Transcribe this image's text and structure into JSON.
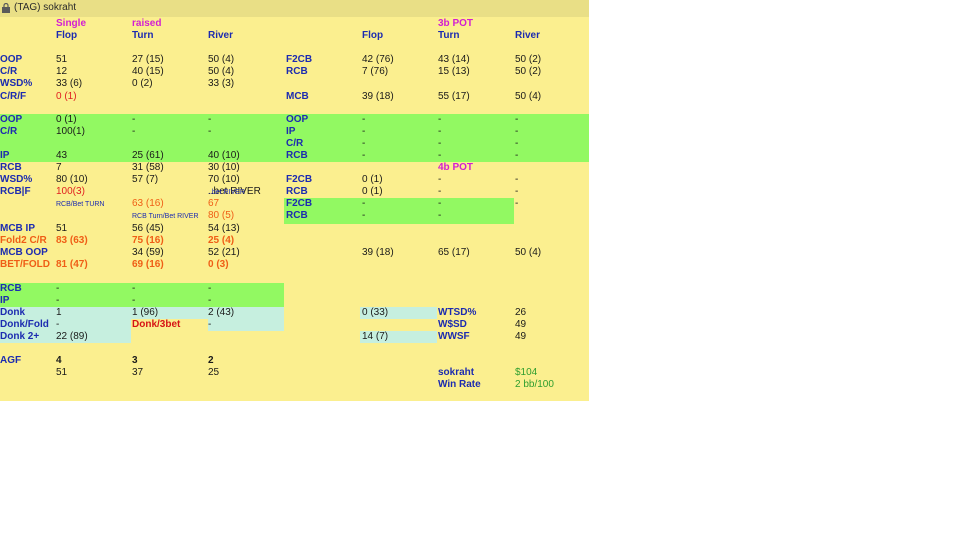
{
  "window": {
    "title": "(TAG) sokraht"
  },
  "colors": {
    "background": "#fbef8f",
    "label": "#1c2bb0",
    "accent": "#d21ed2",
    "green": "#92f962",
    "cyan": "#c6efdf"
  },
  "cells": {
    "h_single": "Single",
    "h_raised": "raised",
    "h_3bpot": "3b POT",
    "h_flop1": "Flop",
    "h_turn1": "Turn",
    "h_river1": "River",
    "h_flop2": "Flop",
    "h_turn2": "Turn",
    "h_river2": "River",
    "r1_l": "OOP",
    "r1_a": "51",
    "r1_b": "27 (15)",
    "r1_c": "50 (4)",
    "r1_l2": "F2CB",
    "r1_d": "42 (76)",
    "r1_e": "43 (14)",
    "r1_f": "50 (2)",
    "r2_l": "C/R",
    "r2_a": "12",
    "r2_b": "40 (15)",
    "r2_c": "50 (4)",
    "r2_l2": "RCB",
    "r2_d": "7 (76)",
    "r2_e": "15 (13)",
    "r2_f": "50 (2)",
    "r3_l": "WSD%",
    "r3_a": "33 (6)",
    "r3_b": "0 (2)",
    "r3_c": "33 (3)",
    "r4_l": "C/R/F",
    "r4_a": "0 (1)",
    "r4_l2": "MCB",
    "r4_d": "39 (18)",
    "r4_e": "55 (17)",
    "r4_f": "50 (4)",
    "g1_l": "OOP",
    "g1_a": "0 (1)",
    "g1_b": "-",
    "g1_c": "-",
    "g1_l2": "OOP",
    "g1_d": "-",
    "g1_e": "-",
    "g1_f": "-",
    "g2_l": "C/R",
    "g2_a": "100(1)",
    "g2_b": "-",
    "g2_c": "-",
    "g2_l2": "IP",
    "g2_d": "-",
    "g2_e": "-",
    "g2_f": "-",
    "g3_l2": "C/R",
    "g3_d": "-",
    "g3_e": "-",
    "g3_f": "-",
    "g4_l2": "RCB",
    "g4_d": "-",
    "g4_e": "-",
    "g4_f": "-",
    "ip_l": "IP",
    "ip_a": "43",
    "ip_b": "25 (61)",
    "ip_c": "40 (10)",
    "h_4bpot": "4b POT",
    "rcb_l": "RCB",
    "rcb_a": "7",
    "rcb_b": "31 (58)",
    "rcb_c": "30 (10)",
    "wsd2_l": "WSD%",
    "wsd2_a": "80 (10)",
    "wsd2_b": "57 (7)",
    "wsd2_c": "70 (10)",
    "f2cb2_l": "F2CB",
    "f2cb2_d": "0 (1)",
    "f2cb2_e": "-",
    "f2cb2_f": "-",
    "rcbf_l": "RCB|F",
    "rcbf_a": "100(3)",
    "rcbf_c": "..bet RIVER",
    "rcb3_l": "RCB",
    "rcb3_d": "0 (1)",
    "rcb3_e": "-",
    "rcb3_f": "-",
    "note_a": "RCB/Bet TURN",
    "note_b1": "63 (16)",
    "note_c1": "67",
    "g5_l": "F2CB",
    "g5_d": "-",
    "g5_e": "-",
    "g5_f": "-",
    "note_b2": "RCB Turn/Bet RIVER",
    "note_c2": "80 (5)",
    "g6_l": "RCB",
    "g6_d": "-",
    "g6_e": "-",
    "mcbip_l": "MCB IP",
    "mcbip_a": "51",
    "mcbip_b": "56 (45)",
    "mcbip_c": "54 (13)",
    "f2cr_l": "Fold2 C/R",
    "f2cr_a": "83 (63)",
    "f2cr_b": "75 (16)",
    "f2cr_c": "25 (4)",
    "mcboop_l": "MCB OOP",
    "mcboop_b": "34 (59)",
    "mcboop_c": "52 (21)",
    "mcboop_d": "39 (18)",
    "mcboop_e": "65 (17)",
    "mcboop_f": "50 (4)",
    "bf_l": "BET/FOLD",
    "bf_a": "81 (47)",
    "bf_b": "69 (16)",
    "bf_c": "0 (3)",
    "g7_l": "RCB",
    "g7_a": "-",
    "g7_b": "-",
    "g7_c": "-",
    "g8_l": "IP",
    "g8_a": "-",
    "g8_b": "-",
    "g8_c": "-",
    "donk_l": "Donk",
    "donk_a": "1",
    "donk_b": "1 (96)",
    "donk_c": "2 (43)",
    "donk_d": "0 (33)",
    "wtsd_l": "WTSD%",
    "wtsd_v": "26",
    "df_l": "Donk/Fold",
    "df_a": "-",
    "df_b": "Donk/3bet",
    "df_c": "-",
    "wssd_l": "W$SD",
    "wssd_v": "49",
    "d2_l": "Donk 2+",
    "d2_a": "22 (89)",
    "d2_d": "14 (7)",
    "wwsf_l": "WWSF",
    "wwsf_v": "49",
    "agf_l": "AGF",
    "agf_a": "4",
    "agf_b": "3",
    "agf_c": "2",
    "agf2_a": "51",
    "agf2_b": "37",
    "agf2_c": "25",
    "player_l": "sokraht",
    "player_v": "$104",
    "wr_l": "Win Rate",
    "wr_v": "2 bb/100"
  }
}
